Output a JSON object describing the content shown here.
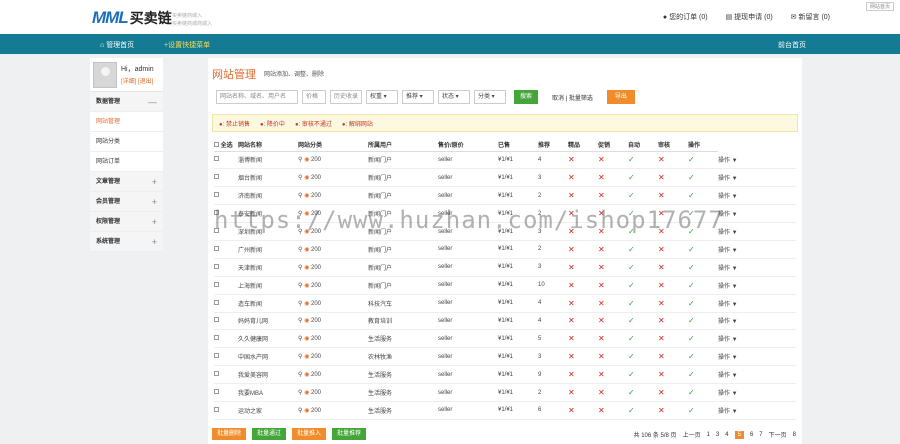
{
  "logo": {
    "mml": "MML",
    "cn": "买卖链",
    "slogan1": "买卖链商城入",
    "slogan2": "买卖链商城商城入"
  },
  "top": {
    "order": "您的订单",
    "order_n": "(0)",
    "withdraw": "提现申请",
    "withdraw_n": "(0)",
    "msg": "新留言",
    "msg_n": "(0)",
    "corner": "网站首页"
  },
  "nav": {
    "home": "管理首页",
    "quick": "+设置快捷菜单",
    "front": "前台首页"
  },
  "user": {
    "name": "Hi，admin",
    "links": "[详细] [退出]"
  },
  "menu": [
    {
      "label": "数据管理",
      "type": "grp",
      "sign": "—"
    },
    {
      "label": "网站管理",
      "type": "act"
    },
    {
      "label": "网站分类",
      "type": "item"
    },
    {
      "label": "网站订单",
      "type": "item"
    },
    {
      "label": "文章管理",
      "type": "grp",
      "sign": "+"
    },
    {
      "label": "会员管理",
      "type": "grp",
      "sign": "+"
    },
    {
      "label": "权限管理",
      "type": "grp",
      "sign": "+"
    },
    {
      "label": "系统管理",
      "type": "grp",
      "sign": "+"
    }
  ],
  "page": {
    "title": "网站管理",
    "subtitle": "网站添加、调整、删除"
  },
  "filter": {
    "keyword": "网站名称、域名、用户名",
    "price": "价格",
    "pr": "历史收录",
    "s1": "权重",
    "s2": "推荐",
    "s3": "状态",
    "s4": "分类",
    "search": "搜索",
    "batch": "取消 | 批量筛选",
    "export": "导出"
  },
  "legend": [
    "●: 禁止销售",
    "●: 降价中",
    "●: 审核不通过",
    "●: 解绑网站"
  ],
  "columns": [
    "全选",
    "网站名称",
    "网站分类",
    "所属用户",
    "售价/原价",
    "已售",
    "推荐",
    "精品",
    "促销",
    "自动",
    "审核",
    "操作"
  ],
  "rows": [
    {
      "name": "淄博新闻",
      "stats": "200",
      "cat": "新闻门户",
      "user": "seller",
      "price": "¥1/¥1",
      "sold": "4",
      "f": [
        "x",
        "x",
        "ok",
        "x",
        "ok"
      ]
    },
    {
      "name": "烟台新闻",
      "stats": "200",
      "cat": "新闻门户",
      "user": "seller",
      "price": "¥1/¥1",
      "sold": "3",
      "f": [
        "x",
        "x",
        "ok",
        "x",
        "ok"
      ]
    },
    {
      "name": "济南新闻",
      "stats": "200",
      "cat": "新闻门户",
      "user": "seller",
      "price": "¥1/¥1",
      "sold": "2",
      "f": [
        "x",
        "x",
        "ok",
        "x",
        "ok"
      ]
    },
    {
      "name": "泰安新闻",
      "stats": "200",
      "cat": "新闻门户",
      "user": "seller",
      "price": "¥1/¥1",
      "sold": "2",
      "f": [
        "x",
        "x",
        "ok",
        "x",
        "ok"
      ]
    },
    {
      "name": "深圳新闻",
      "stats": "200",
      "cat": "新闻门户",
      "user": "seller",
      "price": "¥1/¥1",
      "sold": "3",
      "f": [
        "x",
        "x",
        "ok",
        "x",
        "ok"
      ]
    },
    {
      "name": "广州新闻",
      "stats": "200",
      "cat": "新闻门户",
      "user": "seller",
      "price": "¥1/¥1",
      "sold": "2",
      "f": [
        "x",
        "x",
        "ok",
        "x",
        "ok"
      ]
    },
    {
      "name": "天津新闻",
      "stats": "200",
      "cat": "新闻门户",
      "user": "seller",
      "price": "¥1/¥1",
      "sold": "3",
      "f": [
        "x",
        "x",
        "ok",
        "x",
        "ok"
      ]
    },
    {
      "name": "上海新闻",
      "stats": "200",
      "cat": "新闻门户",
      "user": "seller",
      "price": "¥1/¥1",
      "sold": "10",
      "f": [
        "x",
        "x",
        "ok",
        "x",
        "ok"
      ]
    },
    {
      "name": "造车新闻",
      "stats": "200",
      "cat": "科技汽车",
      "user": "seller",
      "price": "¥1/¥1",
      "sold": "4",
      "f": [
        "x",
        "x",
        "ok",
        "x",
        "ok"
      ]
    },
    {
      "name": "妈妈育儿网",
      "stats": "200",
      "cat": "教育培训",
      "user": "seller",
      "price": "¥1/¥1",
      "sold": "4",
      "f": [
        "x",
        "x",
        "ok",
        "x",
        "ok"
      ]
    },
    {
      "name": "久久健康网",
      "stats": "200",
      "cat": "生活服务",
      "user": "seller",
      "price": "¥1/¥1",
      "sold": "5",
      "f": [
        "x",
        "x",
        "ok",
        "x",
        "ok"
      ]
    },
    {
      "name": "中国水产网",
      "stats": "200",
      "cat": "农林牧渔",
      "user": "seller",
      "price": "¥1/¥1",
      "sold": "3",
      "f": [
        "x",
        "x",
        "ok",
        "x",
        "ok"
      ]
    },
    {
      "name": "我爱美容网",
      "stats": "200",
      "cat": "生活服务",
      "user": "seller",
      "price": "¥1/¥1",
      "sold": "9",
      "f": [
        "x",
        "x",
        "ok",
        "x",
        "ok"
      ]
    },
    {
      "name": "我要MBA",
      "stats": "200",
      "cat": "生活服务",
      "user": "seller",
      "price": "¥1/¥1",
      "sold": "2",
      "f": [
        "x",
        "x",
        "ok",
        "x",
        "ok"
      ]
    },
    {
      "name": "运动之家",
      "stats": "200",
      "cat": "生活服务",
      "user": "seller",
      "price": "¥1/¥1",
      "sold": "6",
      "f": [
        "x",
        "x",
        "ok",
        "x",
        "ok"
      ]
    }
  ],
  "op": "操作 ▼",
  "bulk": [
    {
      "label": "批量删除",
      "color": "#f08d2a"
    },
    {
      "label": "批量通过",
      "color": "#44a53a"
    },
    {
      "label": "批量推入",
      "color": "#f08d2a"
    },
    {
      "label": "批量推荐",
      "color": "#44a53a"
    }
  ],
  "pager": {
    "total": "共 106 条 5/8 页",
    "first": "上一页",
    "pages": [
      "1",
      "3",
      "4",
      "5",
      "6",
      "7"
    ],
    "current": "5",
    "next": "下一页",
    "last": "8"
  },
  "watermark": "https://www.huzhan.com/ishop17677"
}
